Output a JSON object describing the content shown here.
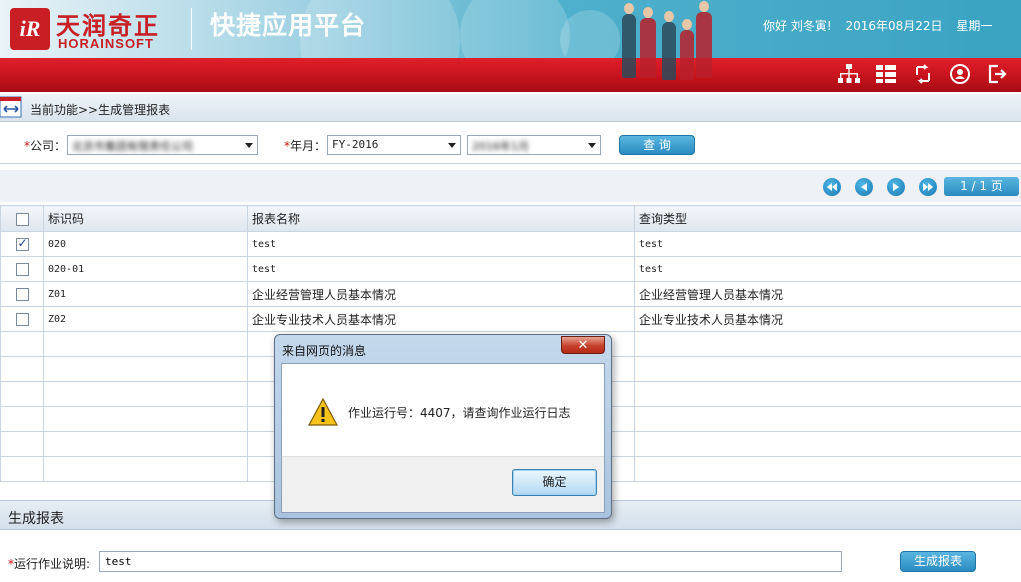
{
  "header": {
    "logo_mark": "iR",
    "logo_cn": "天润奇正",
    "logo_en": "HORAINSOFT",
    "platform_title": "快捷应用平台",
    "greeting": "你好  刘冬寅!",
    "date": "2016年08月22日",
    "weekday": "星期一",
    "toolbar_icons": [
      "org-chart-icon",
      "menu-list-icon",
      "refresh-icon",
      "user-icon",
      "logout-icon"
    ],
    "colors": {
      "brand_red": "#c81e24",
      "banner_blue": "#3aa3c2"
    }
  },
  "breadcrumb": {
    "text": "当前功能>>生成管理报表"
  },
  "filters": {
    "company_label": "公司：",
    "company_value": "北京市集团有限责任公司",
    "yearmonth_label": "年月：",
    "fy_value": "FY-2016",
    "month_value": "2016年1月",
    "query_button": "查  询"
  },
  "pager": {
    "info": "1 / 1 页"
  },
  "grid": {
    "columns": [
      "标识码",
      "报表名称",
      "查询类型"
    ],
    "rows": [
      {
        "checked": true,
        "code": "020",
        "name": "test",
        "type": "test"
      },
      {
        "checked": false,
        "code": "020-01",
        "name": "test",
        "type": "test"
      },
      {
        "checked": false,
        "code": "Z01",
        "name": "企业经营管理人员基本情况",
        "type": "企业经营管理人员基本情况"
      },
      {
        "checked": false,
        "code": "Z02",
        "name": "企业专业技术人员基本情况",
        "type": "企业专业技术人员基本情况"
      }
    ]
  },
  "generate": {
    "panel_title": "生成报表",
    "run_desc_label": "运行作业说明:",
    "run_desc_value": "test",
    "generate_button": "生成报表"
  },
  "dialog": {
    "title": "来自网页的消息",
    "close": "✕",
    "message": "作业运行号：4407，请查询作业运行日志",
    "ok_button": "确定"
  }
}
